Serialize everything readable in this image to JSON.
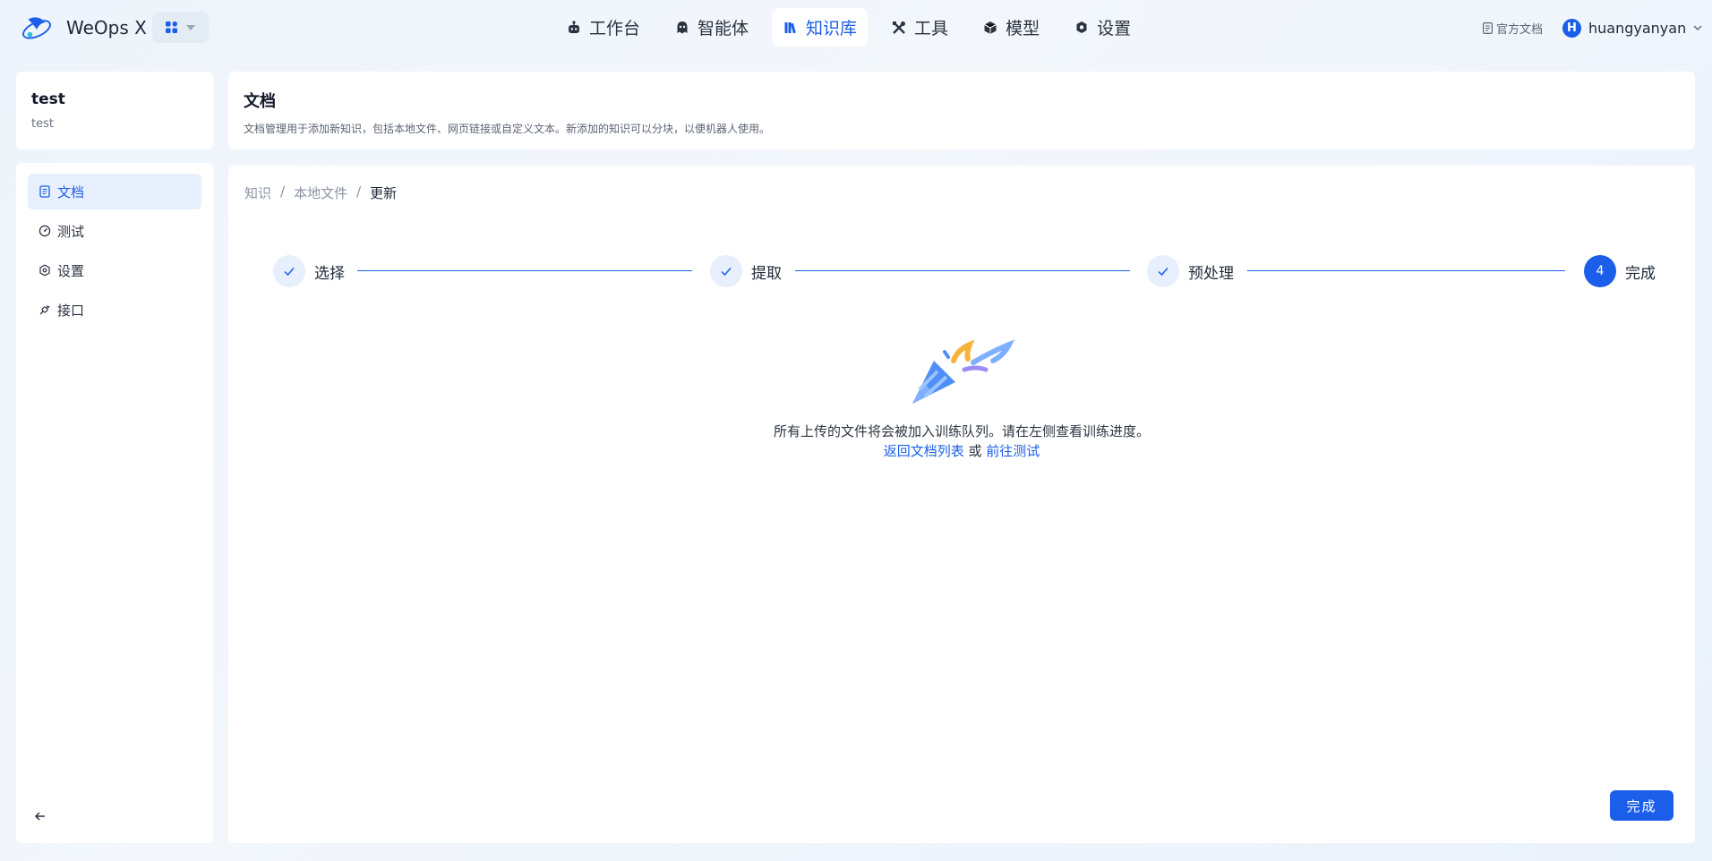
{
  "app": {
    "name": "WeOps X"
  },
  "nav": {
    "items": [
      {
        "label": "工作台",
        "icon": "robot-icon"
      },
      {
        "label": "智能体",
        "icon": "ghost-icon"
      },
      {
        "label": "知识库",
        "icon": "books-icon",
        "active": true
      },
      {
        "label": "工具",
        "icon": "tools-icon"
      },
      {
        "label": "模型",
        "icon": "cube-icon"
      },
      {
        "label": "设置",
        "icon": "gear-icon"
      }
    ]
  },
  "header_right": {
    "doc_link": "官方文档",
    "avatar_letter": "H",
    "username": "huangyanyan"
  },
  "kb": {
    "title": "test",
    "subtitle": "test"
  },
  "sidebar": {
    "items": [
      {
        "label": "文档",
        "icon": "document-icon",
        "active": true
      },
      {
        "label": "测试",
        "icon": "gauge-icon"
      },
      {
        "label": "设置",
        "icon": "gear-icon"
      },
      {
        "label": "接口",
        "icon": "plug-icon"
      }
    ]
  },
  "page": {
    "title": "文档",
    "description": "文档管理用于添加新知识，包括本地文件、网页链接或自定义文本。新添加的知识可以分块，以便机器人使用。"
  },
  "breadcrumb": [
    "知识",
    "本地文件",
    "更新"
  ],
  "steps": [
    {
      "label": "选择",
      "status": "done"
    },
    {
      "label": "提取",
      "status": "done"
    },
    {
      "label": "预处理",
      "status": "done"
    },
    {
      "label": "完成",
      "status": "current",
      "number": "4"
    }
  ],
  "result": {
    "message": "所有上传的文件将会被加入训练队列。请在左侧查看训练进度。",
    "link_back": "返回文档列表",
    "or": "或",
    "link_test": "前往测试"
  },
  "footer": {
    "done_label": "完成"
  },
  "colors": {
    "accent": "#1a5eea",
    "active_bg": "#e9f0fd"
  }
}
